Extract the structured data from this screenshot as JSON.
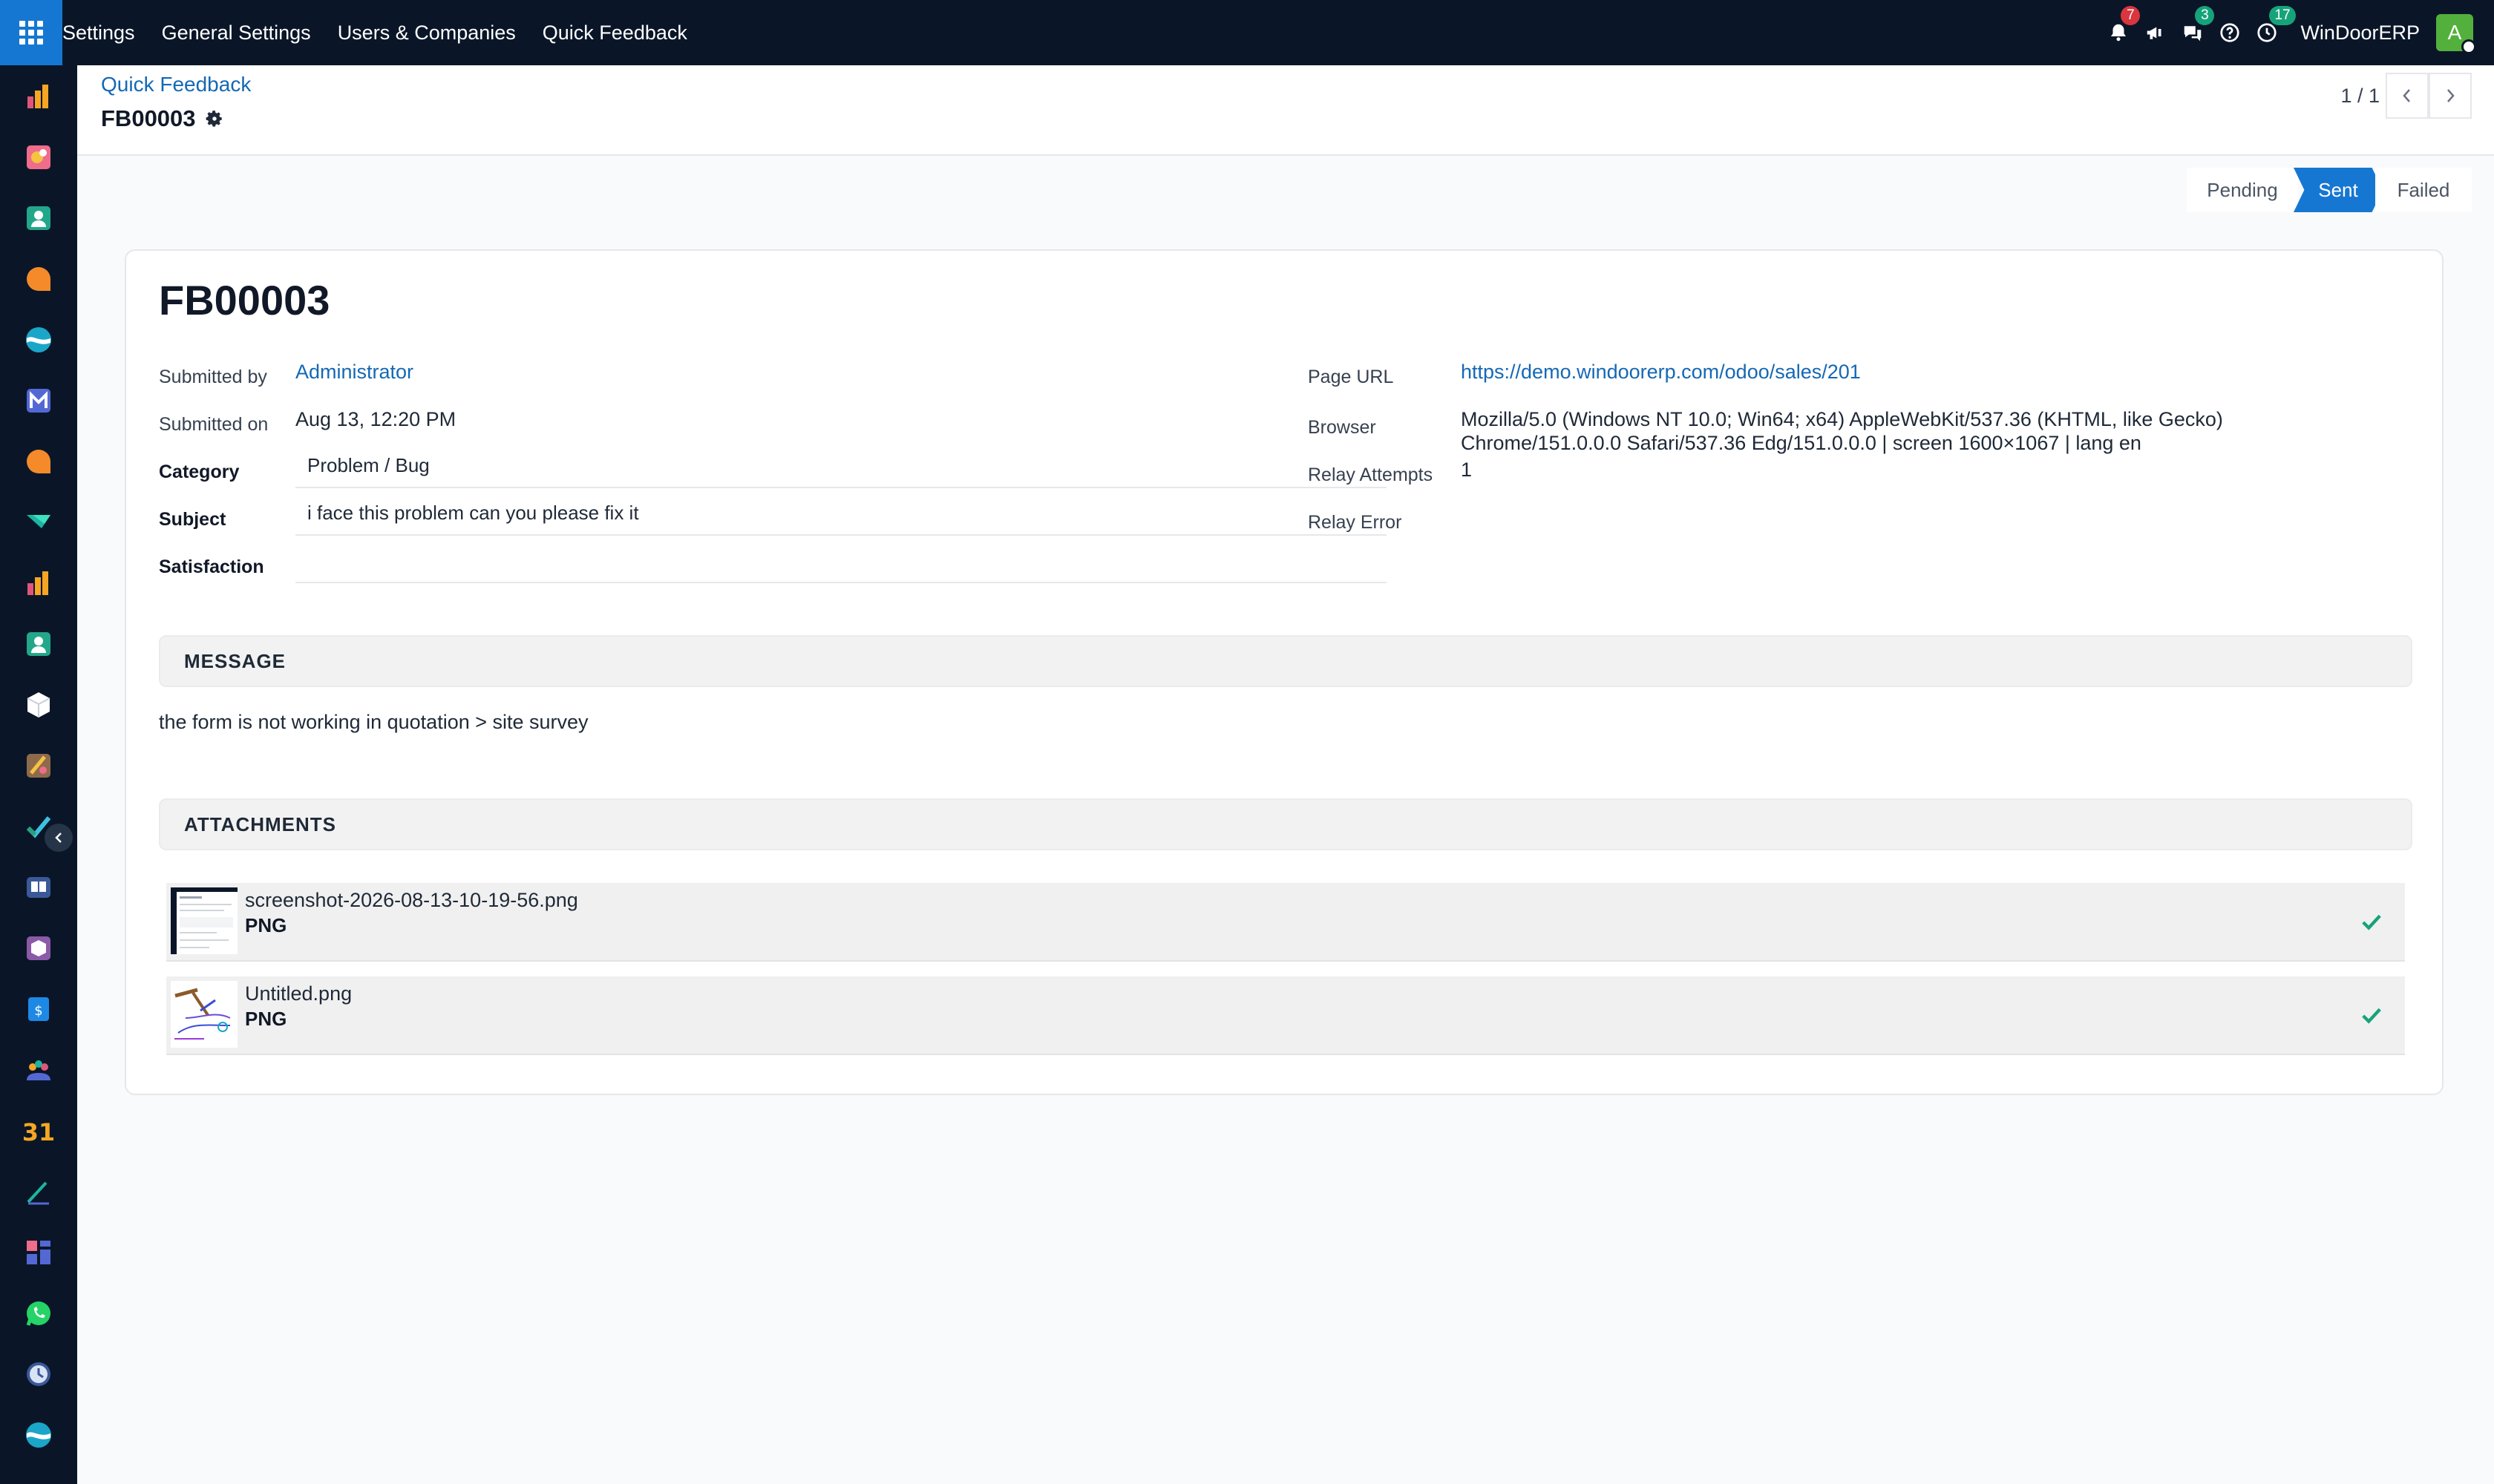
{
  "navbar": {
    "menu": [
      "Settings",
      "General Settings",
      "Users & Companies",
      "Quick Feedback"
    ],
    "notifications_count": "7",
    "messages_count": "3",
    "activities_count": "17",
    "company": "WinDoorERP",
    "avatar_letter": "A",
    "colors": {
      "bar": "#0a1628",
      "apps_button": "#1677d2",
      "badge_red": "#d9363e",
      "badge_green": "#16a37a"
    }
  },
  "sidebar": {
    "icons": [
      "sales-app-icon",
      "art-app-icon",
      "contacts-app-icon",
      "discuss-app-icon",
      "wave-app-icon",
      "mail-app-icon",
      "chat-app-icon",
      "flag-app-icon",
      "reporting-app-icon",
      "contacts-2-app-icon",
      "box-app-icon",
      "craft-app-icon",
      "checkmark-app-icon",
      "book-app-icon",
      "package-app-icon",
      "invoice-app-icon",
      "team-app-icon",
      "calendar-app-icon",
      "pen-app-icon",
      "dashboard-app-icon",
      "whatsapp-app-icon",
      "clock-app-icon",
      "wave-2-app-icon"
    ],
    "calendar_label": "31"
  },
  "control_panel": {
    "breadcrumb": "Quick Feedback",
    "record_name": "FB00003",
    "pager": "1 / 1"
  },
  "status_bar": {
    "stages": [
      "Pending",
      "Sent",
      "Failed"
    ],
    "active": "Sent"
  },
  "form": {
    "title": "FB00003",
    "left": {
      "submitted_by_label": "Submitted by",
      "submitted_by": "Administrator",
      "submitted_on_label": "Submitted on",
      "submitted_on": "Aug 13, 12:20 PM",
      "category_label": "Category",
      "category": "Problem / Bug",
      "subject_label": "Subject",
      "subject": "i face this problem can you please fix it",
      "satisfaction_label": "Satisfaction",
      "satisfaction": ""
    },
    "right": {
      "page_url_label": "Page URL",
      "page_url": "https://demo.windoorerp.com/odoo/sales/201",
      "browser_label": "Browser",
      "browser_line1": "Mozilla/5.0 (Windows NT 10.0; Win64; x64) AppleWebKit/537.36 (KHTML, like Gecko)",
      "browser_line2": "Chrome/151.0.0.0 Safari/537.36 Edg/151.0.0.0 | screen 1600×1067 | lang en",
      "relay_attempts_label": "Relay Attempts",
      "relay_attempts": "1",
      "relay_error_label": "Relay Error",
      "relay_error": ""
    },
    "message_header": "MESSAGE",
    "message": "the form is not working in quotation > site survey",
    "attachments_header": "ATTACHMENTS",
    "attachments": [
      {
        "name": "screenshot-2026-08-13-10-19-56.png",
        "type": "PNG"
      },
      {
        "name": "Untitled.png",
        "type": "PNG"
      }
    ]
  }
}
